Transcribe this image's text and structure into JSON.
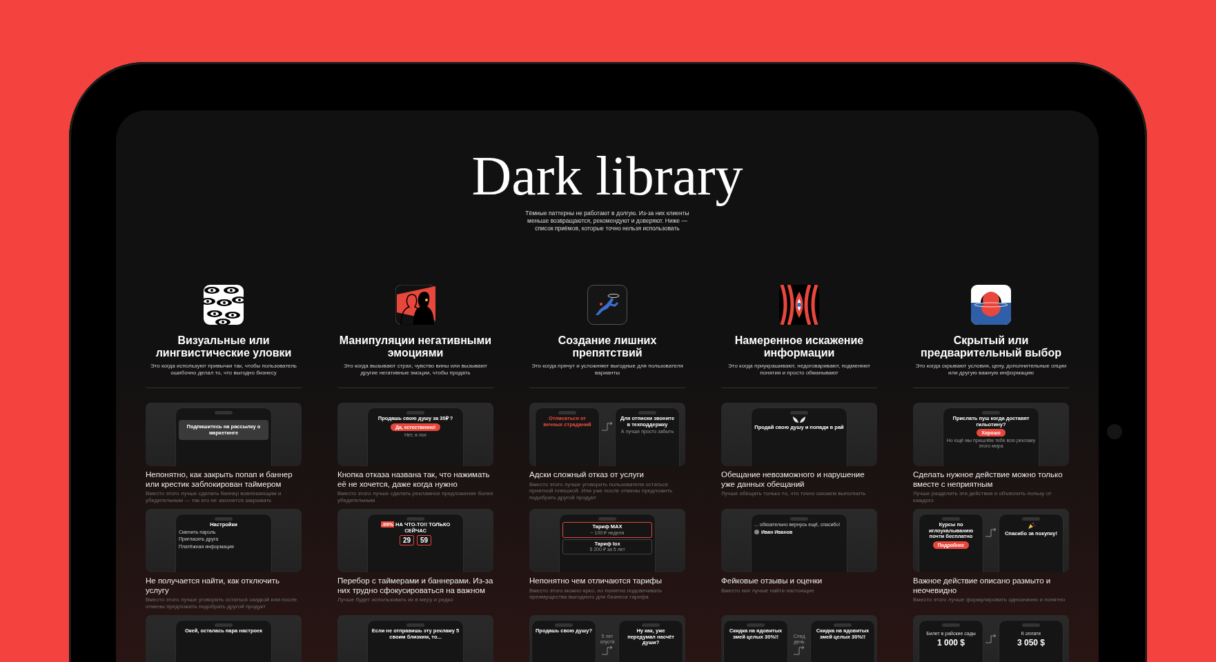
{
  "header": {
    "title": "Dark library",
    "subtitle": "Тёмные паттерны не работают в долгую. Из-за них клиенты меньше возвращаются, рекомендуют и доверяют. Ниже — список приёмов, которые точно нельзя использовать"
  },
  "categories": [
    {
      "title": "Визуальные или лингвистические уловки",
      "description": "Это когда используют привычки так, чтобы пользователь ошибочно делал то, что выгодно бизнесу",
      "patterns": [
        {
          "screens": [
            {
              "kind": "popup",
              "heading": "Подпишитесь на рассылку о маркетинге"
            }
          ],
          "title": "Непонятно, как закрыть попап и баннер или крестик заблокирован таймером",
          "description": "Вместо этого лучше сделать баннер вовлекающим и убедительным — так его не захочется закрывать"
        },
        {
          "screens": [
            {
              "kind": "text",
              "heading": "Настройки",
              "lines": [
                "Сменить пароль",
                "Пригласить друга",
                "Платёжная информация"
              ]
            }
          ],
          "title": "Не получается найти, как отключить услугу",
          "description": "Вместо этого лучше уговорить остаться скидкой или после отмены предложить подобрать другой продукт"
        },
        {
          "screens": [
            {
              "kind": "text",
              "heading": "Окей, осталась пара настроек"
            }
          ]
        }
      ]
    },
    {
      "title": "Манипуляции негативными эмоциями",
      "description": "Это когда вызывают страх, чувство вины или вызывают другие негативные эмоции, чтобы продать",
      "patterns": [
        {
          "screens": [
            {
              "kind": "text",
              "heading": "Продашь свою душу за 30₽ ?",
              "button": "Да, естественно!",
              "note": "Нет, я лох"
            }
          ],
          "title": "Кнопка отказа названа так, что нажимать её не хочется, даже когда нужно",
          "description": "Вместо этого лучше сделать рекламное предложение более убедительным"
        },
        {
          "screens": [
            {
              "kind": "text",
              "badge": "-99%",
              "heading": "НА ЧТО-ТО!! ТОЛЬКО СЕЙЧАС",
              "timer": [
                "29",
                "59"
              ]
            }
          ],
          "title": "Перебор с таймерами и баннерами. Из-за них трудно сфокусироваться на важном",
          "description": "Лучше будет использовать их в меру и редко"
        },
        {
          "screens": [
            {
              "kind": "text",
              "heading": "Если не отправишь эту рекламу 5 своим близким, то..."
            }
          ]
        }
      ]
    },
    {
      "title": "Создание лишних препятствий",
      "description": "Это когда прячут и усложняют выгодные для пользователя варианты",
      "patterns": [
        {
          "screens": [
            {
              "kind": "alert",
              "heading": "Отписаться от вечных страданий"
            },
            {
              "kind": "text",
              "heading": "Для отписки звоните в техподдержку",
              "note": "А лучше просто забыть"
            }
          ],
          "title": "Адски сложный отказ от услуги",
          "description": "Вместо этого лучше уговорить пользователя остаться приятной плюшкой. Или уже после отмены предложить подобрать другой продукт"
        },
        {
          "screens": [
            {
              "kind": "text",
              "boxes": [
                {
                  "heading": "Тариф MAX",
                  "note": "~ 100 ₽ неделя"
                },
                {
                  "heading": "Тариф lox",
                  "note": "5 200 ₽ за 5 лет"
                }
              ]
            }
          ],
          "title": "Непонятно чем отличаются тарифы",
          "description": "Вместо этого можно ярко, но понятно подсвечивать преимущества выгодного для бизнеса тарифа"
        },
        {
          "screens": [
            {
              "kind": "text",
              "heading": "Продашь свою душу?"
            },
            {
              "kind": "text",
              "heading": "Ну как, уже передумал насчёт души?"
            }
          ],
          "connector": "5 лет спустя"
        }
      ]
    },
    {
      "title": "Намеренное искажение информации",
      "description": "Это когда приукрашивают, недоговаривают, подменяют понятия и просто обманывают",
      "patterns": [
        {
          "screens": [
            {
              "kind": "wings",
              "heading": "Продай свою душу и попади в рай"
            }
          ],
          "title": "Обещание невозможного и нарушение уже данных обещаний",
          "description": "Лучше обещать только то, что точно сможем выполнить"
        },
        {
          "screens": [
            {
              "kind": "text",
              "lines": [
                "... обязательно вернусь ещё, спасибо!"
              ],
              "author": "Иван Иванов"
            }
          ],
          "title": "Фейковые отзывы и оценки",
          "description": "Вместо них лучше найти настоящие"
        },
        {
          "screens": [
            {
              "kind": "text",
              "heading": "Скидка на ядовитых змей целых 30%!!"
            },
            {
              "kind": "text",
              "heading": "Скидка на ядовитых змей целых 30%!!"
            }
          ],
          "connector": "След день"
        }
      ]
    },
    {
      "title": "Скрытый или предварительный выбор",
      "description": "Это когда скрывают условия, цену, дополнительные опции или другую важную информацию",
      "patterns": [
        {
          "screens": [
            {
              "kind": "text",
              "heading": "Прислать пуш когда доставят гильотину?",
              "note": "Но ещё мы пришлём тебе всю рекламу этого мира",
              "button": "Хорошо"
            }
          ],
          "title": "Сделать нужное действие можно только вместе с неприятным",
          "description": "Лучше разделить эти действия и объяснить пользу от каждого"
        },
        {
          "screens": [
            {
              "kind": "text",
              "heading": "Курсы по иглоукалыванию почти бесплатно",
              "button": "Подробнее"
            },
            {
              "kind": "party",
              "heading": "Спасибо за покупку!"
            }
          ],
          "title": "Важное действие описано размыто и неочевидно",
          "description": "Вместо этого лучше формулировать однозначно и понятно"
        },
        {
          "screens": [
            {
              "kind": "text",
              "label": "Билет в райские сады",
              "amount": "1 000 $"
            },
            {
              "kind": "text",
              "label": "К оплате",
              "amount": "3 050 $"
            }
          ]
        }
      ]
    }
  ]
}
